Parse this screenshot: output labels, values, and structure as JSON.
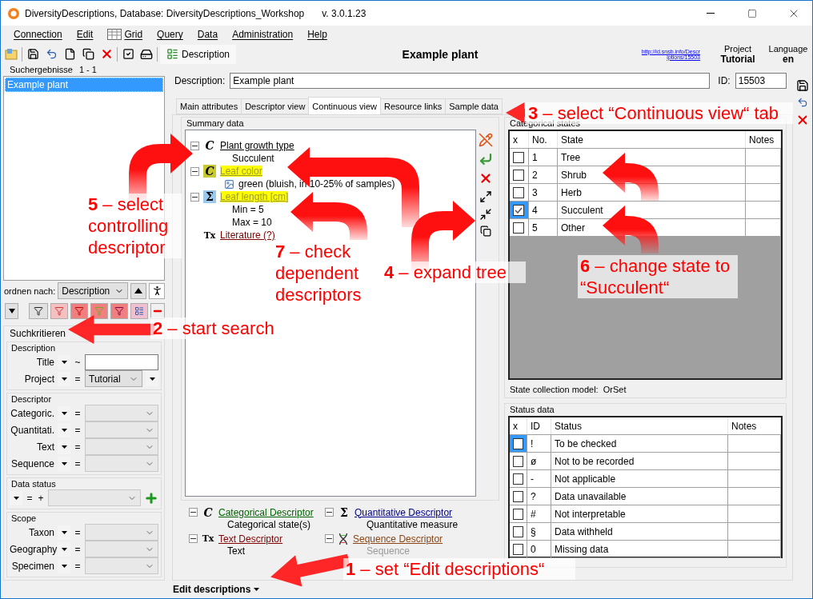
{
  "window": {
    "title": "DiversityDescriptions,  Database: DiversityDescriptions_Workshop",
    "version": "v. 3.0.1.23"
  },
  "menu": [
    "Connection",
    "Edit",
    "Grid",
    "Query",
    "Data",
    "Administration",
    "Help"
  ],
  "toolbar": {
    "description_button": "Description",
    "heading": "Example plant",
    "link_lines": [
      "http://id.snsb.info/Descr",
      "iptions/15503"
    ],
    "project_label": "Project",
    "project": "Tutorial",
    "language_label": "Language",
    "language": "en"
  },
  "search_results": {
    "label": "Suchergebnisse",
    "count": "1 - 1",
    "items": [
      {
        "label": "Example plant",
        "selected": true
      }
    ]
  },
  "sort": {
    "label": "ordnen nach:",
    "value": "Description"
  },
  "search_criteria": {
    "title": "Suchkritieren",
    "groups": [
      {
        "title": "Description",
        "rows": [
          {
            "label": "Title",
            "operator": "~",
            "kind": "text"
          },
          {
            "label": "Project",
            "operator": "=",
            "kind": "combo",
            "value": "Tutorial",
            "extra_caret": true
          }
        ]
      },
      {
        "title": "Descriptor",
        "rows": [
          {
            "label": "Categoric.",
            "operator": "=",
            "kind": "combo"
          },
          {
            "label": "Quantitati.",
            "operator": "=",
            "kind": "combo"
          },
          {
            "label": "Text",
            "operator": "=",
            "kind": "combo"
          },
          {
            "label": "Sequence",
            "operator": "=",
            "kind": "combo"
          }
        ]
      },
      {
        "title": "Data status",
        "rows": [
          {
            "operator": "=",
            "prefix": "+",
            "kind": "combo-add"
          }
        ]
      },
      {
        "title": "Scope",
        "rows": [
          {
            "label": "Taxon",
            "operator": "=",
            "kind": "combo"
          },
          {
            "label": "Geography",
            "operator": "=",
            "kind": "combo"
          },
          {
            "label": "Specimen",
            "operator": "=",
            "kind": "combo"
          }
        ]
      }
    ]
  },
  "description": {
    "label": "Description:",
    "value": "Example plant",
    "id_label": "ID:",
    "id": "15503"
  },
  "tabs": [
    {
      "label": "Main attributes",
      "selected": false
    },
    {
      "label": "Descriptor view",
      "selected": false
    },
    {
      "label": "Continuous view",
      "selected": true
    },
    {
      "label": "Resource links",
      "selected": false
    },
    {
      "label": "Sample data",
      "selected": false
    }
  ],
  "summary": {
    "title": "Summary data",
    "tree": [
      {
        "kind": "categorical",
        "symbol": "C",
        "label": "Plant growth type",
        "highlight": false,
        "expanded": true,
        "children": [
          {
            "kind": "value",
            "label": "Succulent"
          }
        ]
      },
      {
        "kind": "categorical",
        "symbol": "C",
        "label": "Leaf color",
        "highlight": true,
        "expanded": true,
        "children": [
          {
            "kind": "image-value",
            "label": "green (bluish, in 10-25% of samples)"
          }
        ]
      },
      {
        "kind": "quantitative",
        "symbol": "Σ",
        "label": "Leaf length [cm]",
        "highlight": true,
        "expanded": true,
        "children": [
          {
            "kind": "value",
            "label": "Min = 5"
          },
          {
            "kind": "value",
            "label": "Max = 10"
          }
        ]
      },
      {
        "kind": "text",
        "symbol": "Tx",
        "label": "Literature (?)",
        "highlight": false
      }
    ]
  },
  "legend": [
    {
      "kind": "categorical",
      "symbol": "C",
      "label": "Categorical Descriptor",
      "sub": "Categorical state(s)"
    },
    {
      "kind": "quantitative",
      "symbol": "Σ",
      "label": "Quantitative Descriptor",
      "sub": "Quantitative measure"
    },
    {
      "kind": "text",
      "symbol": "Tx",
      "label": "Text Descriptor",
      "sub": "Text"
    },
    {
      "kind": "sequence",
      "label": "Sequence Descriptor",
      "sub": "Sequence"
    }
  ],
  "categorical_states": {
    "title": "Categorical states",
    "columns": [
      "x",
      "No.",
      "State",
      "Notes"
    ],
    "rows": [
      {
        "checked": false,
        "current": false,
        "no": "1",
        "state": "Tree"
      },
      {
        "checked": false,
        "current": false,
        "no": "2",
        "state": "Shrub"
      },
      {
        "checked": false,
        "current": false,
        "no": "3",
        "state": "Herb"
      },
      {
        "checked": true,
        "current": true,
        "no": "4",
        "state": "Succulent"
      },
      {
        "checked": false,
        "current": false,
        "no": "5",
        "state": "Other"
      }
    ],
    "model_label": "State collection model:",
    "model": "OrSet"
  },
  "status_data": {
    "title": "Status data",
    "columns": [
      "x",
      "ID",
      "Status",
      "Notes"
    ],
    "rows": [
      {
        "checked": false,
        "current": true,
        "id": "!",
        "status": "To be checked"
      },
      {
        "checked": false,
        "current": false,
        "id": "ø",
        "status": "Not to be recorded"
      },
      {
        "checked": false,
        "current": false,
        "id": "-",
        "status": "Not applicable"
      },
      {
        "checked": false,
        "current": false,
        "id": "?",
        "status": "Data unavailable"
      },
      {
        "checked": false,
        "current": false,
        "id": "#",
        "status": "Not interpretable"
      },
      {
        "checked": false,
        "current": false,
        "id": "§",
        "status": "Data withheld"
      },
      {
        "checked": false,
        "current": false,
        "id": "0",
        "status": "Missing data"
      }
    ]
  },
  "status_bar": {
    "mode": "Edit descriptions"
  },
  "annotations": [
    "**3** – select “Continuous view“ tab",
    "**5** – select controlling descriptor",
    "**7** – check dependent descriptors",
    "**4** – expand tree",
    "**6** – change state to “Succulent“",
    "**2** – start search",
    "**1** – set “Edit descriptions“"
  ]
}
